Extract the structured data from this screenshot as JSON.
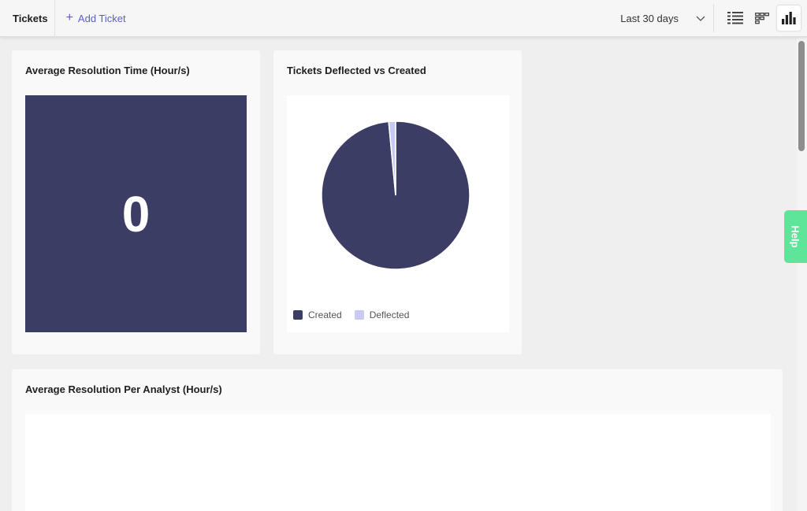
{
  "topbar": {
    "title": "Tickets",
    "add_ticket_label": "Add Ticket",
    "add_icon": "plus-icon",
    "range_label": "Last 30 days",
    "views": [
      {
        "name": "list-view",
        "icon": "list-icon",
        "active": false
      },
      {
        "name": "board-view",
        "icon": "board-icon",
        "active": false
      },
      {
        "name": "chart-view",
        "icon": "bar-chart-icon",
        "active": true
      }
    ]
  },
  "cards": {
    "avg_resolution": {
      "title": "Average Resolution Time (Hour/s)",
      "value": "0",
      "color": "#3c3d64"
    },
    "deflected_vs_created": {
      "title": "Tickets Deflected vs Created"
    },
    "per_analyst": {
      "title": "Average Resolution Per Analyst (Hour/s)"
    }
  },
  "chart_data": {
    "type": "pie",
    "categories": [
      "Created",
      "Deflected"
    ],
    "values": [
      98.5,
      1.5
    ],
    "colors": [
      "#3c3d64",
      "#c9caf3"
    ],
    "legend": "bottom-left"
  },
  "help": {
    "label": "Help",
    "color": "#5ee59a"
  }
}
